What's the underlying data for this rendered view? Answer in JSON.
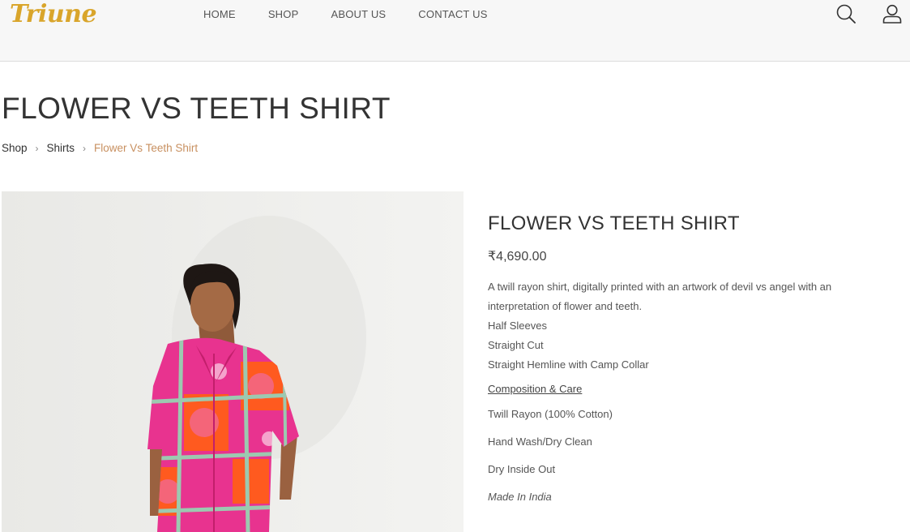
{
  "brand": {
    "logo_text": "Triune",
    "logo_color": "#d9a52b"
  },
  "nav": {
    "items": [
      "HOME",
      "SHOP",
      "ABOUT US",
      "CONTACT US"
    ]
  },
  "header_icons": [
    "search-icon",
    "user-icon"
  ],
  "page_title": "FLOWER VS TEETH SHIRT",
  "breadcrumb": {
    "items": [
      "Shop",
      "Shirts",
      "Flower Vs Teeth Shirt"
    ],
    "current_color": "#c89060"
  },
  "product": {
    "title": "FLOWER VS TEETH SHIRT",
    "price": "₹4,690.00",
    "description": [
      "A twill rayon shirt, digitally printed with an artwork of devil vs angel with an interpretation of flower and teeth.",
      "Half Sleeves",
      "Straight Cut",
      "Straight Hemline with Camp Collar"
    ],
    "care_link": "Composition & Care",
    "care": [
      "Twill Rayon (100% Cotton)",
      "Hand Wash/Dry Clean",
      "Dry Inside Out",
      "Made In India"
    ]
  },
  "colors": {
    "shirt_pink": "#e8338f",
    "shirt_orange": "#ff5a1f",
    "shirt_grid": "#9cc9b0"
  }
}
